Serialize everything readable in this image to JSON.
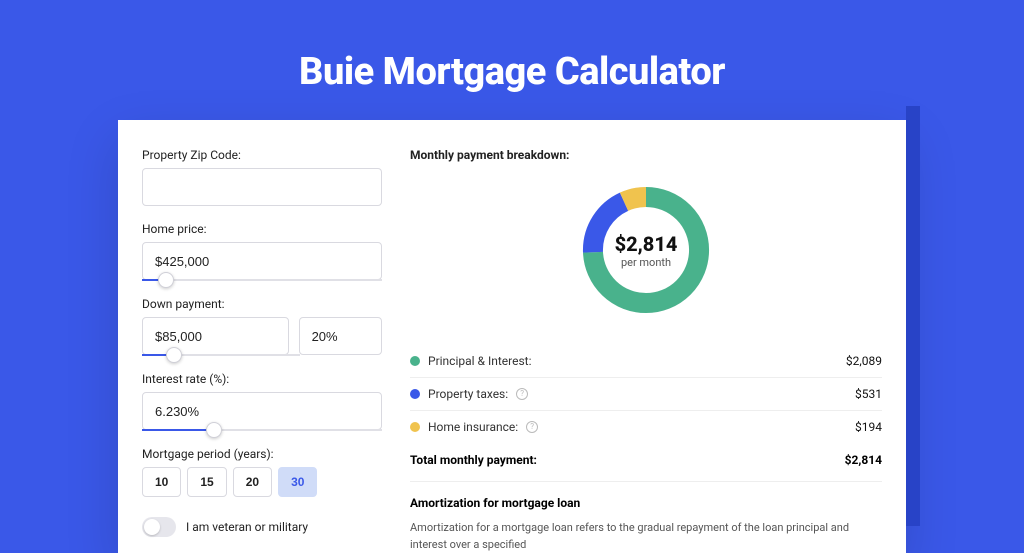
{
  "page": {
    "title": "Buie Mortgage Calculator"
  },
  "form": {
    "zip_label": "Property Zip Code:",
    "zip_value": "",
    "home_price_label": "Home price:",
    "home_price_value": "$425,000",
    "home_price_slider_pct": 10,
    "down_payment_label": "Down payment:",
    "down_payment_value": "$85,000",
    "down_payment_pct_value": "20%",
    "down_payment_slider_pct": 20,
    "interest_label": "Interest rate (%):",
    "interest_value": "6.230%",
    "interest_slider_pct": 30,
    "period_label": "Mortgage period (years):",
    "periods": [
      "10",
      "15",
      "20",
      "30"
    ],
    "period_selected": "30",
    "veteran_label": "I am veteran or military",
    "veteran_on": false
  },
  "breakdown": {
    "title": "Monthly payment breakdown:",
    "center_amount": "$2,814",
    "center_sub": "per month",
    "items": [
      {
        "label": "Principal & Interest:",
        "value": "$2,089",
        "color": "#49b28c",
        "info": false
      },
      {
        "label": "Property taxes:",
        "value": "$531",
        "color": "#3a58e8",
        "info": true
      },
      {
        "label": "Home insurance:",
        "value": "$194",
        "color": "#f0c34e",
        "info": true
      }
    ],
    "total_label": "Total monthly payment:",
    "total_value": "$2,814"
  },
  "chart_data": {
    "type": "pie",
    "title": "Monthly payment breakdown",
    "series": [
      {
        "name": "Principal & Interest",
        "value": 2089,
        "color": "#49b28c"
      },
      {
        "name": "Property taxes",
        "value": 531,
        "color": "#3a58e8"
      },
      {
        "name": "Home insurance",
        "value": 194,
        "color": "#f0c34e"
      }
    ],
    "total": 2814,
    "center_label": "$2,814 per month"
  },
  "amortization": {
    "title": "Amortization for mortgage loan",
    "body": "Amortization for a mortgage loan refers to the gradual repayment of the loan principal and interest over a specified"
  }
}
